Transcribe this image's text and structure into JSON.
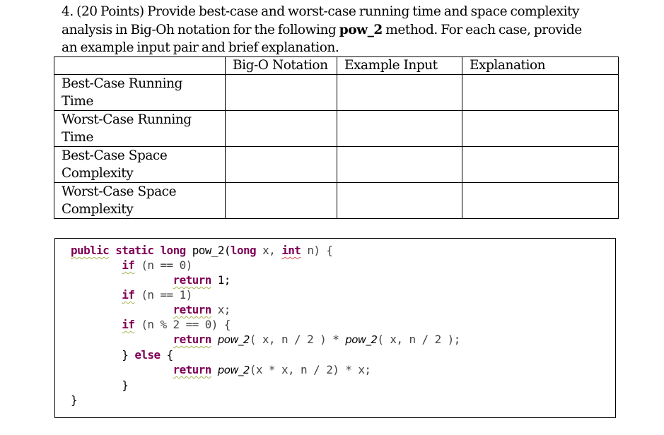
{
  "question": {
    "line1": "4. (20 Points) Provide best-case and worst-case running time and space complexity",
    "line2_pre": "analysis in Big-Oh notation for the following ",
    "line2_bold": "pow_2",
    "line2_post": " method.  For each case, provide",
    "line3": "an example input pair and brief explanation."
  },
  "table": {
    "headers": [
      "",
      "Big-O Notation",
      "Example Input",
      "Explanation"
    ],
    "rows": [
      {
        "label_line1": "Best-Case Running",
        "label_line2": "Time",
        "big_o": "",
        "example": "",
        "explanation": ""
      },
      {
        "label_line1": "Worst-Case Running",
        "label_line2": "Time",
        "big_o": "",
        "example": "",
        "explanation": ""
      },
      {
        "label_line1": "Best-Case Space",
        "label_line2": "Complexity",
        "big_o": "",
        "example": "",
        "explanation": ""
      },
      {
        "label_line1": "Worst-Case Space",
        "label_line2": "Complexity",
        "big_o": "",
        "example": "",
        "explanation": ""
      }
    ]
  },
  "code": {
    "kw_public": "public",
    "kw_static": "static",
    "kw_long": "long",
    "kw_int": "int",
    "kw_if": "if",
    "kw_return": "return",
    "kw_else": "else",
    "method_name": "pow_2",
    "sig_params_open": "(",
    "sig_long2": "long",
    "sig_x": " x, ",
    "sig_n": " n) {",
    "line_if0": " (n == 0)",
    "line_ret1": " 1;",
    "line_if1": " (n == 1)",
    "line_retx": " x;",
    "line_ifmod": " (n % 2 == 0) {",
    "line_ret_even_a": "( x, n / 2 ) * ",
    "line_ret_even_b": "( x, n / 2 );",
    "line_else_open": "} ",
    "line_else_close": " {",
    "line_ret_odd": "(x * x, n / 2) * x;",
    "inner_close": "}",
    "outer_close": "}"
  }
}
